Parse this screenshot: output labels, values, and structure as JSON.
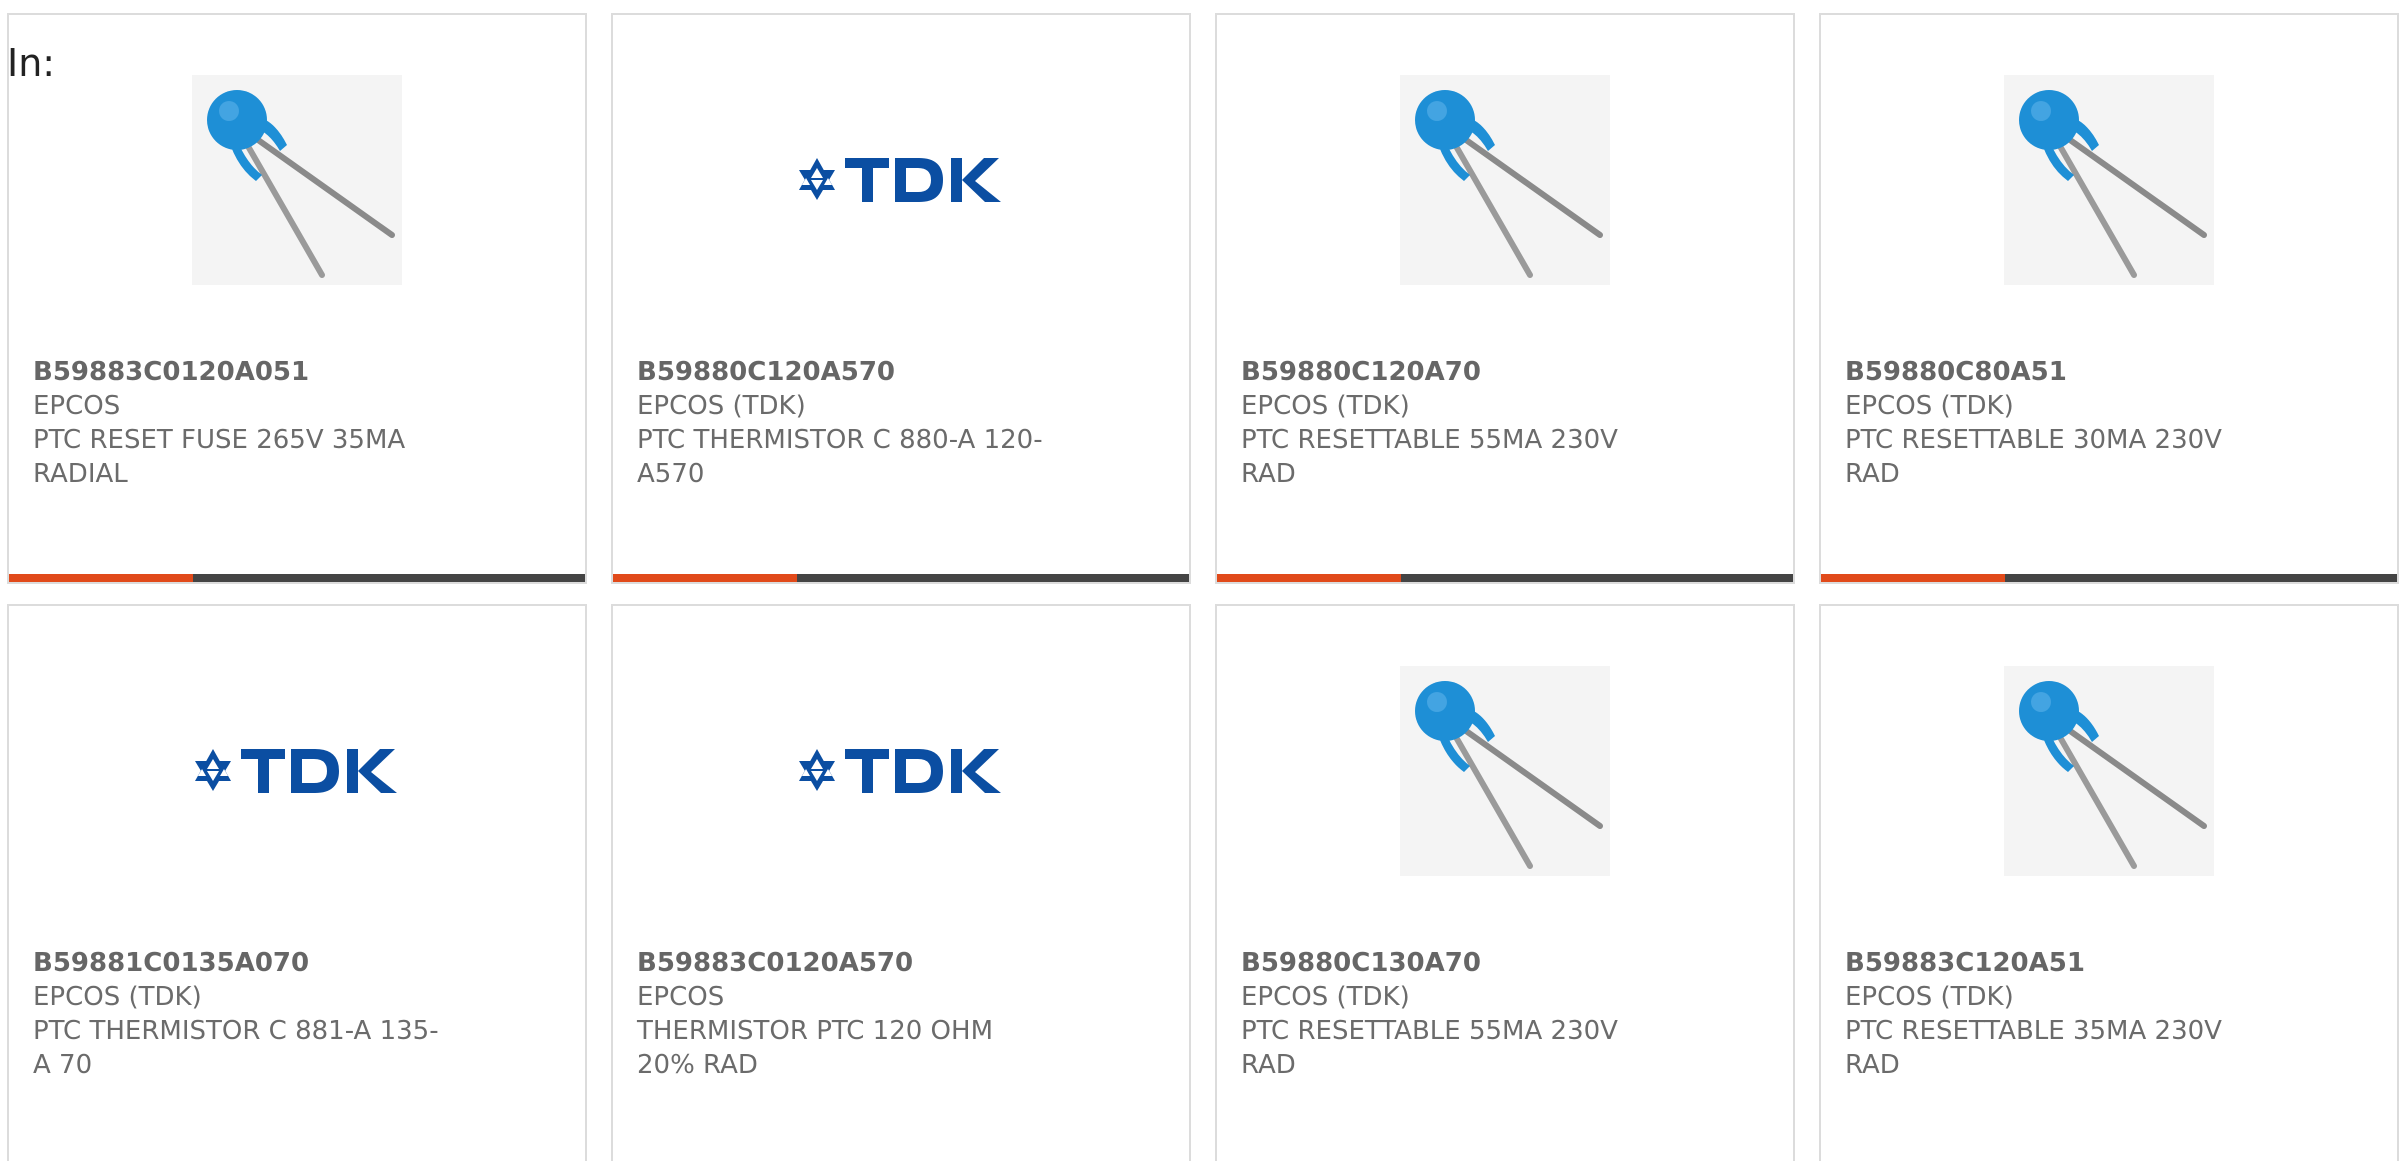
{
  "filter_label": "In:",
  "colors": {
    "accent": "#e14a1a",
    "bar": "#444444",
    "tdk_blue": "#0b4ea2",
    "thermistor_blue": "#1e8fd6"
  },
  "cards": [
    {
      "part_no": "B59883C0120A051",
      "maker": "EPCOS",
      "desc": "PTC RESET FUSE 265V 35MA RADIAL",
      "image": "thermistor-photo",
      "accent_fraction": 0.32
    },
    {
      "part_no": "B59880C120A570",
      "maker": "EPCOS (TDK)",
      "desc": "PTC THERMISTOR C 880-A 120-A570",
      "image": "tdk-logo",
      "accent_fraction": 0.32
    },
    {
      "part_no": "B59880C120A70",
      "maker": "EPCOS (TDK)",
      "desc": "PTC RESETTABLE 55MA 230V RAD",
      "image": "thermistor-photo",
      "accent_fraction": 0.32
    },
    {
      "part_no": "B59880C80A51",
      "maker": "EPCOS (TDK)",
      "desc": "PTC RESETTABLE 30MA 230V RAD",
      "image": "thermistor-photo",
      "accent_fraction": 0.32
    },
    {
      "part_no": "B59881C0135A070",
      "maker": "EPCOS (TDK)",
      "desc": "PTC THERMISTOR C 881-A 135-A 70",
      "image": "tdk-logo"
    },
    {
      "part_no": "B59883C0120A570",
      "maker": "EPCOS",
      "desc": "THERMISTOR PTC 120 OHM 20% RAD",
      "image": "tdk-logo"
    },
    {
      "part_no": "B59880C130A70",
      "maker": "EPCOS (TDK)",
      "desc": "PTC RESETTABLE 55MA 230V RAD",
      "image": "thermistor-photo"
    },
    {
      "part_no": "B59883C120A51",
      "maker": "EPCOS (TDK)",
      "desc": "PTC RESETTABLE 35MA 230V RAD",
      "image": "thermistor-photo"
    }
  ]
}
